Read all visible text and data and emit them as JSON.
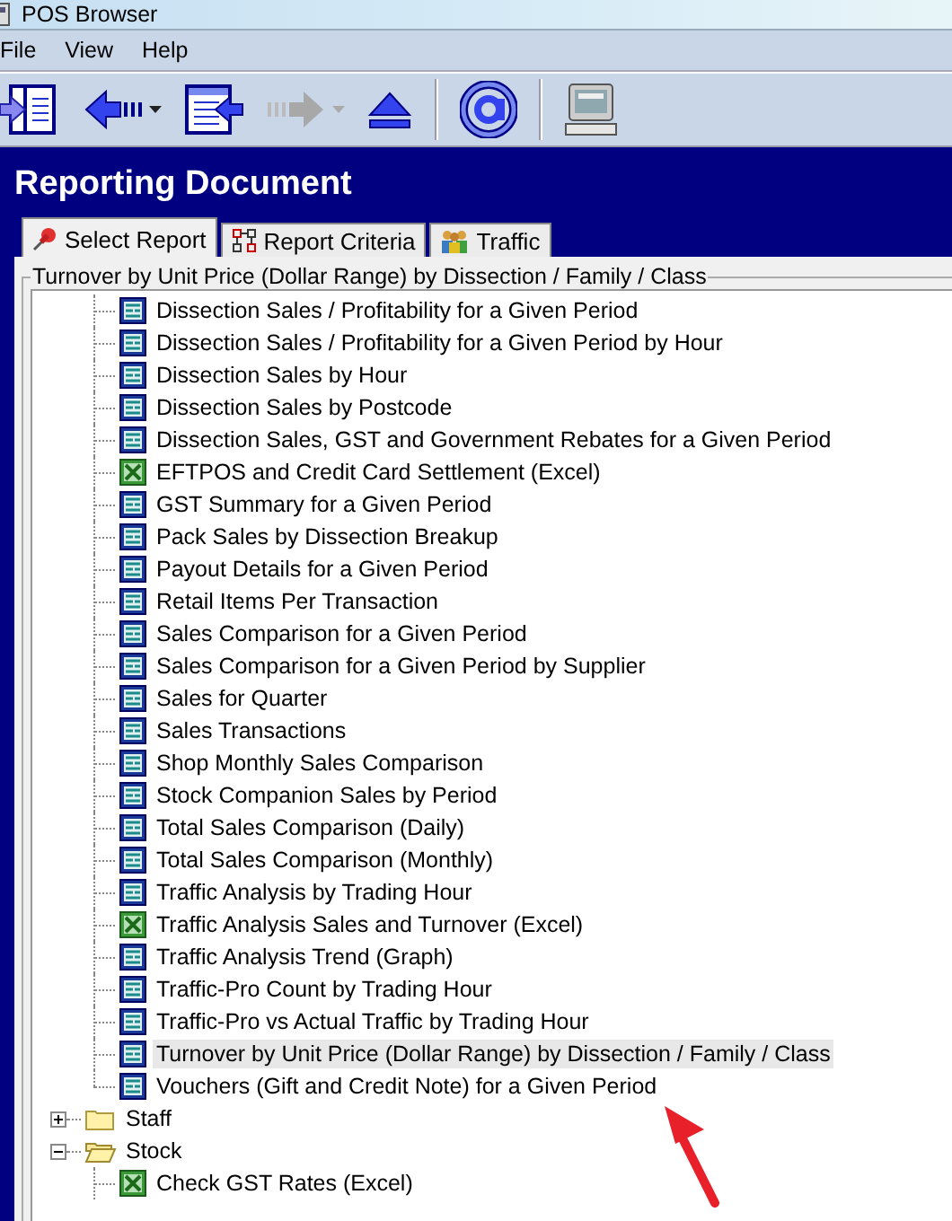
{
  "window": {
    "title": "POS Browser"
  },
  "menu": [
    "File",
    "View",
    "Help"
  ],
  "toolbar": [
    {
      "kind": "panel",
      "disabled": false,
      "dropdown": false
    },
    {
      "kind": "back",
      "disabled": false,
      "dropdown": true
    },
    {
      "kind": "page",
      "disabled": false,
      "dropdown": false
    },
    {
      "kind": "forward",
      "disabled": true,
      "dropdown": true
    },
    {
      "kind": "eject",
      "disabled": false,
      "dropdown": false
    },
    {
      "kind": "separator"
    },
    {
      "kind": "email",
      "disabled": false,
      "dropdown": false
    },
    {
      "kind": "separator"
    },
    {
      "kind": "computer",
      "disabled": false,
      "dropdown": false
    }
  ],
  "heading": "Reporting Document",
  "tabs": [
    {
      "label": "Select Report",
      "kind": "pin",
      "selected": true
    },
    {
      "label": "Report Criteria",
      "kind": "diagram",
      "selected": false
    },
    {
      "label": "Traffic",
      "kind": "people",
      "selected": false
    }
  ],
  "group_title": "Turnover by Unit Price (Dollar Range) by Dissection  / Family / Class",
  "tree": [
    {
      "kind": "continuation",
      "children": [
        {
          "label": "Dissection Sales / Profitability for a Given Period",
          "kind": "report",
          "selected": false
        },
        {
          "label": "Dissection Sales / Profitability for a Given Period by Hour",
          "kind": "report",
          "selected": false
        },
        {
          "label": "Dissection Sales by Hour",
          "kind": "report",
          "selected": false
        },
        {
          "label": "Dissection Sales by Postcode",
          "kind": "report",
          "selected": false
        },
        {
          "label": "Dissection Sales, GST and Government Rebates for a Given Period",
          "kind": "report",
          "selected": false
        },
        {
          "label": "EFTPOS and Credit Card Settlement (Excel)",
          "kind": "excel",
          "selected": false
        },
        {
          "label": "GST Summary for a Given Period",
          "kind": "report",
          "selected": false
        },
        {
          "label": "Pack Sales by Dissection Breakup",
          "kind": "report",
          "selected": false
        },
        {
          "label": "Payout Details for a Given Period",
          "kind": "report",
          "selected": false
        },
        {
          "label": "Retail Items Per Transaction",
          "kind": "report",
          "selected": false
        },
        {
          "label": "Sales Comparison for a Given Period",
          "kind": "report",
          "selected": false
        },
        {
          "label": "Sales Comparison for a Given Period by Supplier",
          "kind": "report",
          "selected": false
        },
        {
          "label": "Sales for Quarter",
          "kind": "report",
          "selected": false
        },
        {
          "label": "Sales Transactions",
          "kind": "report",
          "selected": false
        },
        {
          "label": "Shop Monthly Sales Comparison",
          "kind": "report",
          "selected": false
        },
        {
          "label": "Stock Companion Sales by Period",
          "kind": "report",
          "selected": false
        },
        {
          "label": "Total Sales Comparison (Daily)",
          "kind": "report",
          "selected": false
        },
        {
          "label": "Total Sales Comparison (Monthly)",
          "kind": "report",
          "selected": false
        },
        {
          "label": "Traffic Analysis by Trading Hour",
          "kind": "report",
          "selected": false
        },
        {
          "label": "Traffic Analysis Sales and Turnover (Excel)",
          "kind": "excel",
          "selected": false
        },
        {
          "label": "Traffic Analysis Trend (Graph)",
          "kind": "report",
          "selected": false
        },
        {
          "label": "Traffic-Pro Count by Trading Hour",
          "kind": "report",
          "selected": false
        },
        {
          "label": "Traffic-Pro vs Actual Traffic by Trading Hour",
          "kind": "report",
          "selected": false
        },
        {
          "label": "Turnover by Unit Price (Dollar Range) by Dissection  / Family / Class",
          "kind": "report",
          "selected": true
        },
        {
          "label": "Vouchers (Gift and Credit Note) for a Given Period",
          "kind": "report",
          "selected": false
        }
      ]
    },
    {
      "label": "Staff",
      "kind": "folder",
      "expanded": false
    },
    {
      "label": "Stock",
      "kind": "folder",
      "expanded": true,
      "children": [
        {
          "label": "Check GST Rates (Excel)",
          "kind": "excel",
          "selected": false
        }
      ]
    }
  ]
}
